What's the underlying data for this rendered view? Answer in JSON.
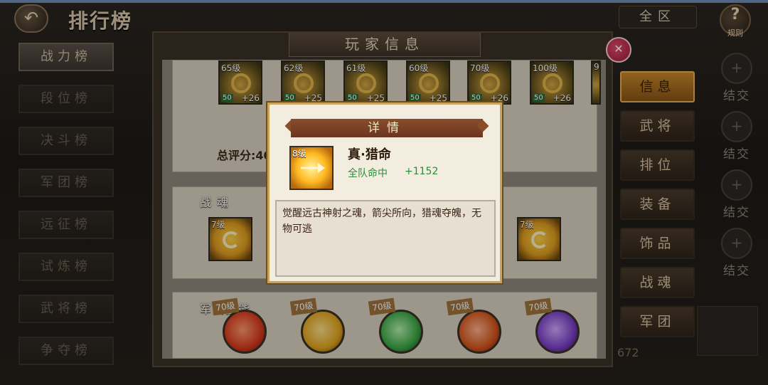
{
  "header": {
    "back_icon": "back-arrow-icon",
    "title": "排行榜",
    "region": "全区",
    "rules_label": "规则"
  },
  "rank_tabs": [
    {
      "label": "战力榜",
      "active": true
    },
    {
      "label": "段位榜"
    },
    {
      "label": "决斗榜"
    },
    {
      "label": "军团榜"
    },
    {
      "label": "远征榜"
    },
    {
      "label": "试炼榜"
    },
    {
      "label": "武将榜"
    },
    {
      "label": "争夺榜"
    }
  ],
  "player_panel": {
    "title": "玩家信息",
    "equipment": [
      {
        "level": "65级",
        "refine": "50",
        "plus": "+26"
      },
      {
        "level": "62级",
        "refine": "50",
        "plus": "+25"
      },
      {
        "level": "61级",
        "refine": "50",
        "plus": "+25"
      },
      {
        "level": "60级",
        "refine": "50",
        "plus": "+25"
      },
      {
        "level": "70级",
        "refine": "50",
        "plus": "+26"
      },
      {
        "level": "100级",
        "refine": "50",
        "plus": "+26"
      },
      {
        "level": "9"
      }
    ],
    "total_score_label": "总评分:40",
    "soul_section_label": "战魂",
    "souls": [
      {
        "level": "7级"
      },
      {
        "level": "7级"
      }
    ],
    "skill_section_label": "军团技能",
    "skills": [
      {
        "level": "70级",
        "color": "#d93a1e"
      },
      {
        "level": "70级",
        "color": "#e2a51d"
      },
      {
        "level": "70级",
        "color": "#3aa845"
      },
      {
        "level": "70级",
        "color": "#d7551e"
      },
      {
        "level": "70级",
        "color": "#7a3ec8"
      }
    ]
  },
  "side_buttons": [
    {
      "label": "信息",
      "active": true
    },
    {
      "label": "武将"
    },
    {
      "label": "排位"
    },
    {
      "label": "装备"
    },
    {
      "label": "饰品"
    },
    {
      "label": "战魂"
    },
    {
      "label": "军团"
    }
  ],
  "friends": [
    {
      "label": "结交"
    },
    {
      "label": "结交"
    },
    {
      "label": "结交"
    },
    {
      "label": "结交"
    }
  ],
  "stray_number": "672",
  "detail_modal": {
    "title": "详情",
    "soul_level": "8级",
    "soul_name": "真·猎命",
    "stat_label": "全队命中",
    "stat_value": "+1152",
    "description": "觉醒远古神射之魂，箭尖所向，猎魂夺魄，无物可逃"
  },
  "colors": {
    "accent": "#c8882a",
    "modal_header": "#7a3f24",
    "stat_green": "#2e8a3e"
  }
}
